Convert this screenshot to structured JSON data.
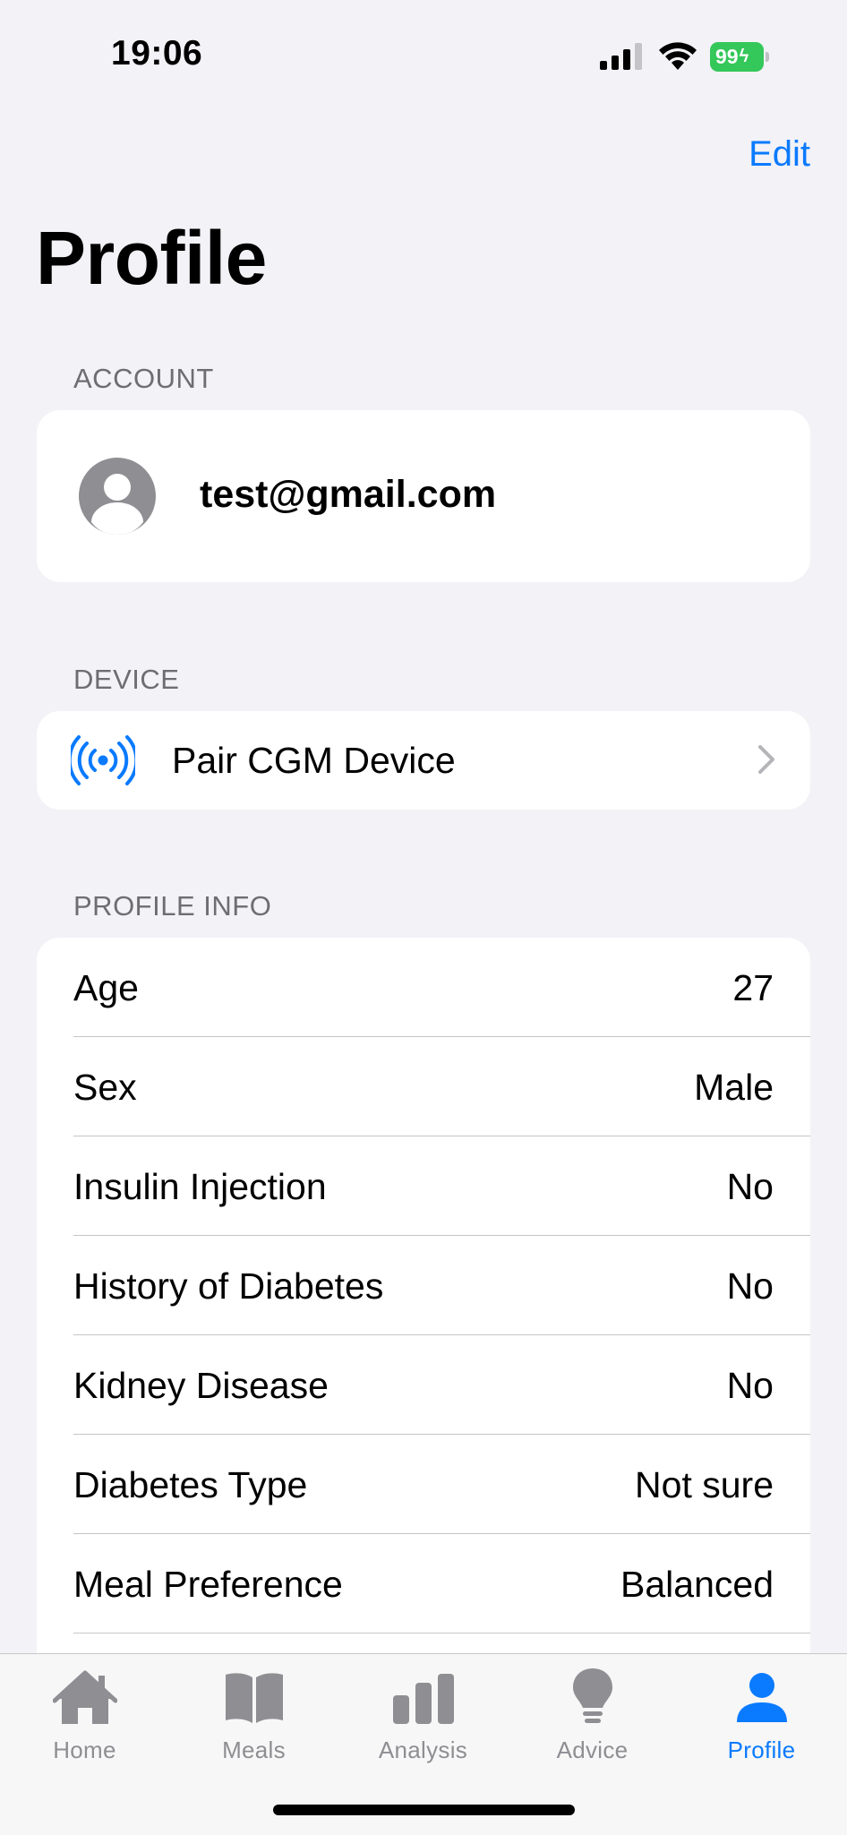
{
  "status_bar": {
    "time": "19:06",
    "battery": "99"
  },
  "nav": {
    "edit_label": "Edit",
    "title": "Profile"
  },
  "account": {
    "header": "ACCOUNT",
    "email": "test@gmail.com"
  },
  "device": {
    "header": "DEVICE",
    "pair_label": "Pair CGM Device"
  },
  "profile_info": {
    "header": "PROFILE INFO",
    "rows": [
      {
        "label": "Age",
        "value": "27"
      },
      {
        "label": "Sex",
        "value": "Male"
      },
      {
        "label": "Insulin Injection",
        "value": "No"
      },
      {
        "label": "History of Diabetes",
        "value": "No"
      },
      {
        "label": "Kidney Disease",
        "value": "No"
      },
      {
        "label": "Diabetes Type",
        "value": "Not sure"
      },
      {
        "label": "Meal Preference",
        "value": "Balanced"
      }
    ]
  },
  "tab_bar": {
    "tabs": [
      {
        "label": "Home",
        "icon": "house-icon"
      },
      {
        "label": "Meals",
        "icon": "book-icon"
      },
      {
        "label": "Analysis",
        "icon": "chart-bar-icon"
      },
      {
        "label": "Advice",
        "icon": "lightbulb-icon"
      },
      {
        "label": "Profile",
        "icon": "person-icon"
      }
    ],
    "active_tab": "Profile"
  },
  "colors": {
    "accent": "#0a7aff",
    "background": "#f2f2f7",
    "secondary_text": "#6d6d72",
    "inactive_tab": "#8e8e93",
    "battery": "#34c759"
  }
}
